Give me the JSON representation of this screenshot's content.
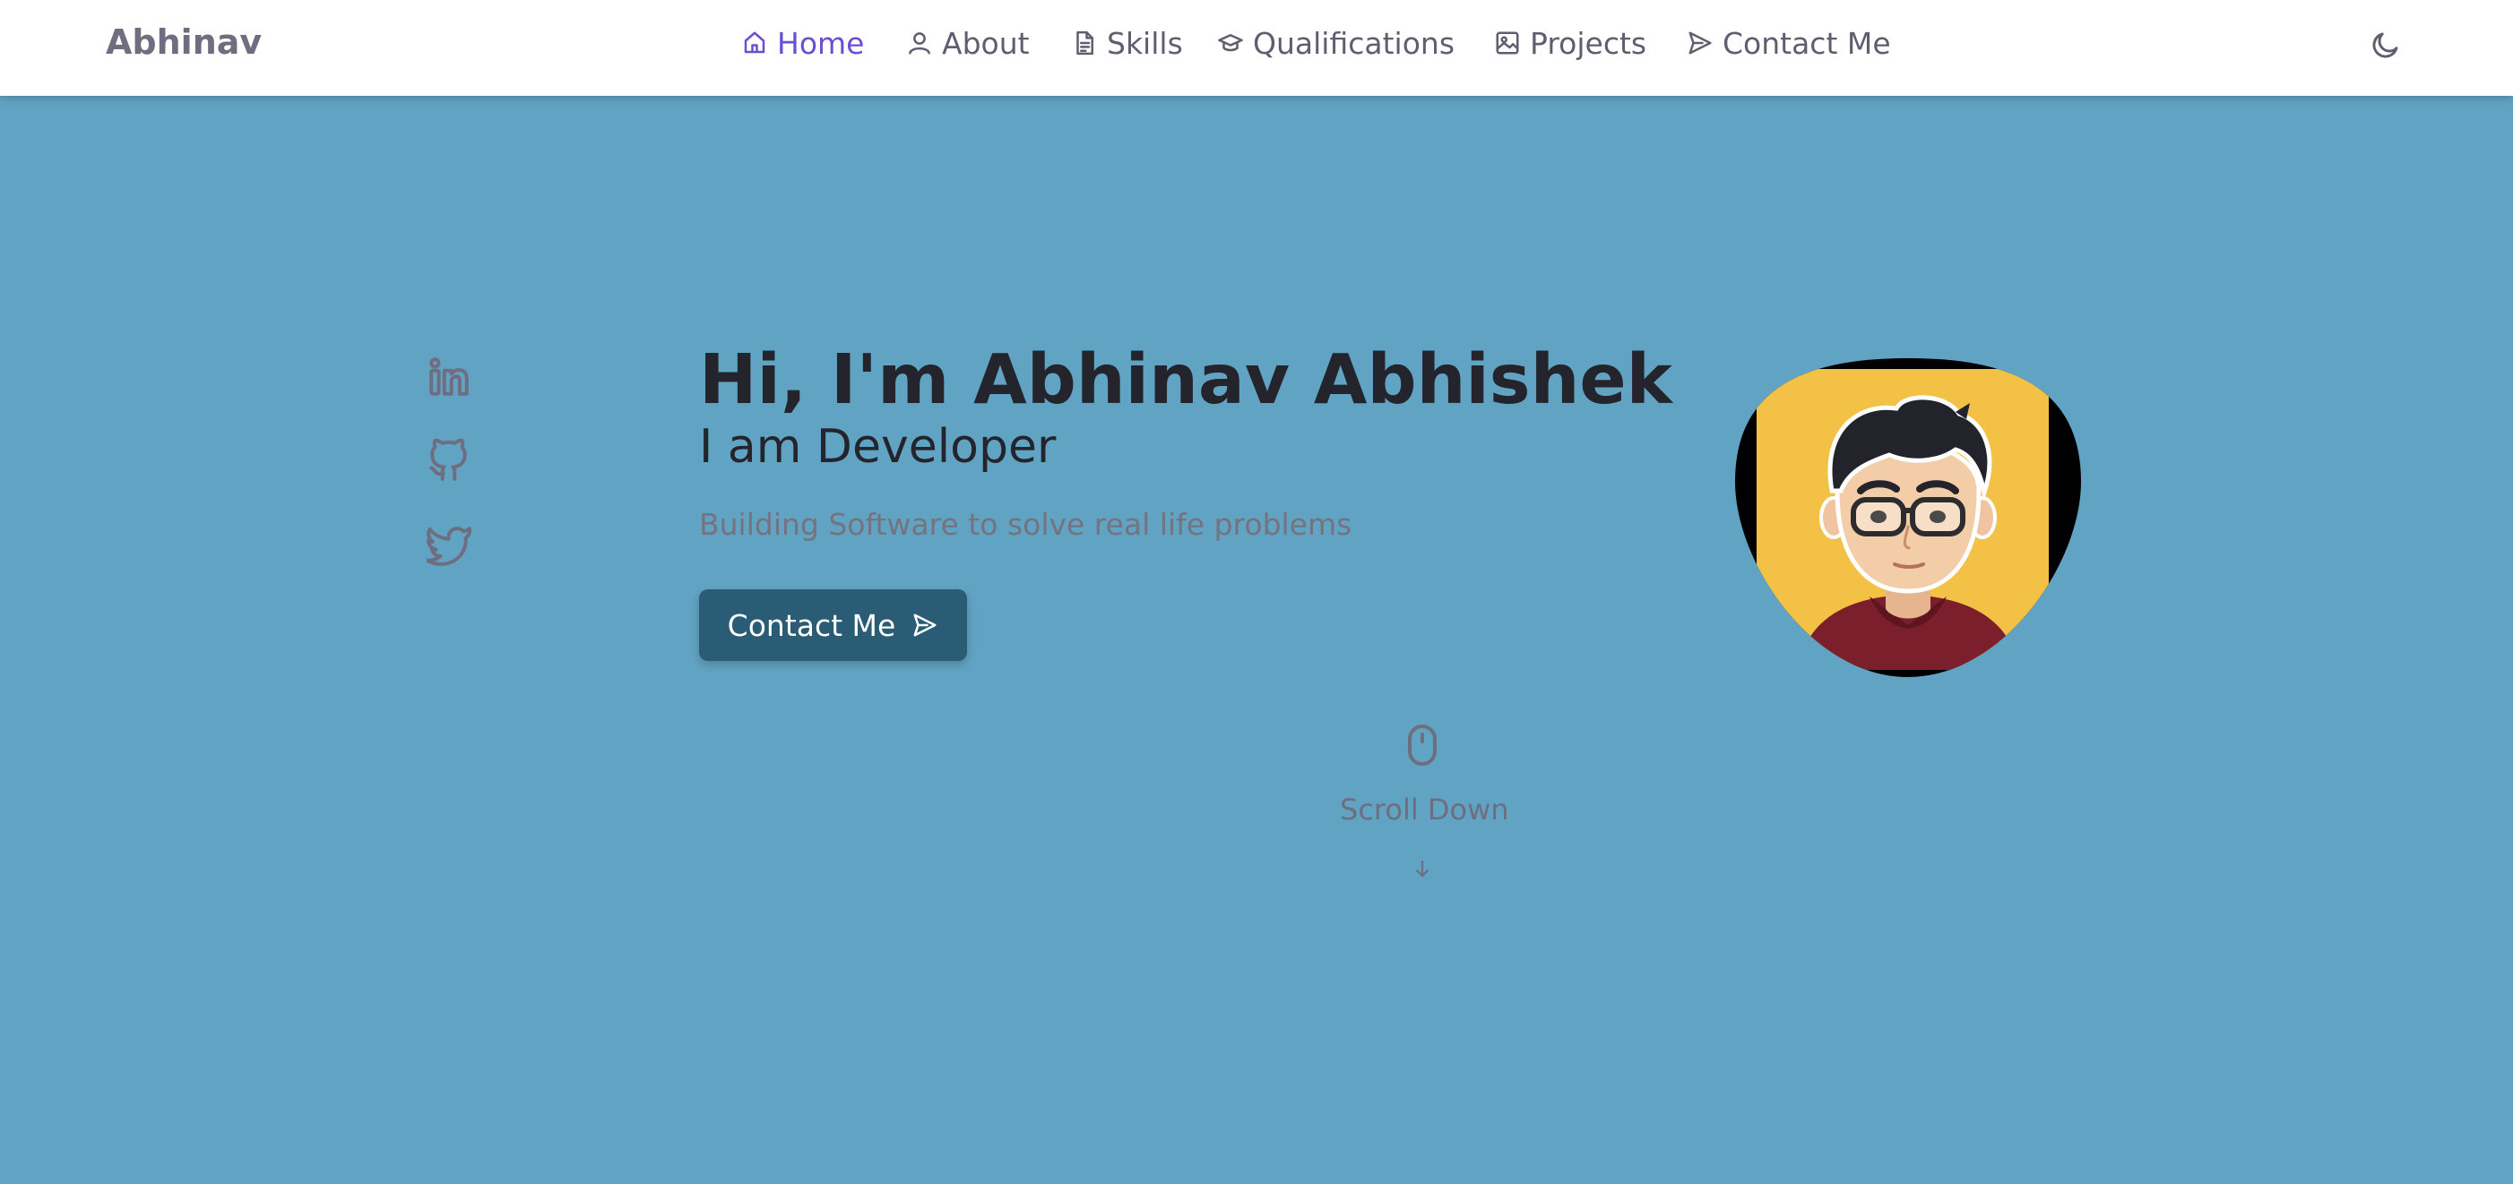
{
  "header": {
    "brand": "Abhinav",
    "nav": [
      {
        "label": "Home",
        "icon": "home-icon",
        "active": true
      },
      {
        "label": "About",
        "icon": "user-icon",
        "active": false
      },
      {
        "label": "Skills",
        "icon": "document-icon",
        "active": false
      },
      {
        "label": "Qualifications",
        "icon": "graduation-cap-icon",
        "active": false
      },
      {
        "label": "Projects",
        "icon": "image-icon",
        "active": false
      },
      {
        "label": "Contact Me",
        "icon": "send-icon",
        "active": false
      }
    ],
    "theme_toggle_icon": "moon-icon"
  },
  "social": [
    "linkedin-icon",
    "github-icon",
    "twitter-icon"
  ],
  "hero": {
    "title": "Hi, I'm Abhinav Abhishek",
    "subtitle": "I am Developer",
    "description": "Building Software to solve real life problems",
    "button_label": "Contact Me"
  },
  "scroll": {
    "label": "Scroll Down"
  },
  "colors": {
    "background": "#61a3c3",
    "header": "#ffffff",
    "accent": "#6a4fd6",
    "button": "#2a5c75",
    "avatar_background": "#f3c146"
  }
}
